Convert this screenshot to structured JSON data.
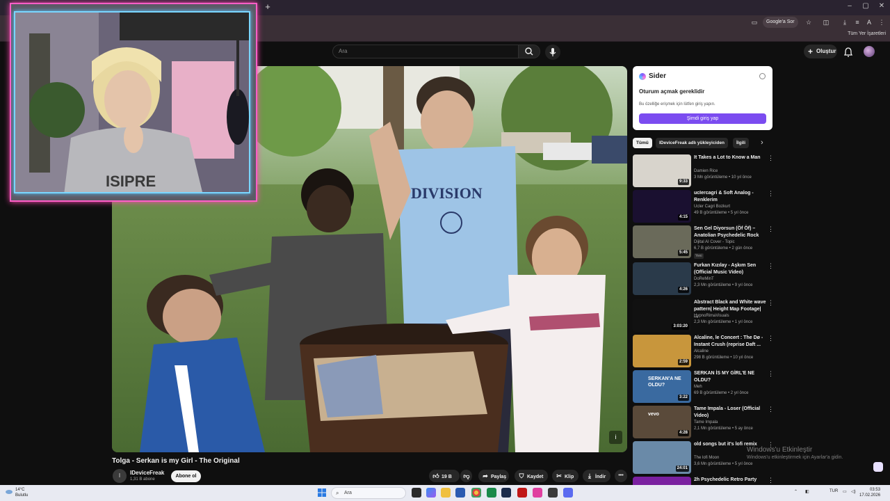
{
  "browser": {
    "new_tab": "+",
    "window_controls": [
      "–",
      "▢",
      "✕"
    ],
    "google_chip": "Google'a Sor",
    "bookmarks_all": "Tüm Yer İşaretleri",
    "profile_initial": "A"
  },
  "header": {
    "search_placeholder": "Ara",
    "create_label": "Oluştur",
    "create_icon": "plus-icon"
  },
  "video": {
    "title": "Tolga - Serkan is my Girl - The Original",
    "info_label": "i",
    "channel": {
      "avatar_initial": "I",
      "name": "IDeviceFreak",
      "subscribers": "1,31 B abone",
      "subscribe_label": "Abone ol"
    },
    "actions": {
      "likes": "19 B",
      "share": "Paylaş",
      "save": "Kaydet",
      "clip": "Klip",
      "download": "İndir",
      "more": "•••"
    }
  },
  "sider": {
    "title": "Sider",
    "heading": "Oturum açmak gereklidir",
    "description": "Bu özelliğe erişmek için lütfen giriş yapın.",
    "button": "Şimdi giriş yap"
  },
  "chips": [
    "Tümü",
    "IDeviceFreak adlı yükleyiciden",
    "İlgili"
  ],
  "recommendations": [
    {
      "title": "It Takes a Lot to Know a Man",
      "channel": "Damien Rice",
      "meta": "3 Mn görüntüleme • 10 yıl önce",
      "duration": "9:33",
      "thumb": "#d8d4cc"
    },
    {
      "title": "ucIercagri & Soft Analog - Renklerim",
      "channel": "Ucler Cagri Bozkurt",
      "meta": "49 B görüntüleme • 5 yıl önce",
      "duration": "4:15",
      "thumb": "#1a1030"
    },
    {
      "title": "Sen Gel Diyorsun (Öf Öf) – Anatolian Psychedelic Rock",
      "channel": "Dijital AI Cover - Topic",
      "meta": "6,7 B görüntüleme • 2 gün önce",
      "badge": "Yeni",
      "duration": "5:45",
      "thumb": "#6a6a5a"
    },
    {
      "title": "Furkan Kızılay - Aşkım Sen (Official Music Video)",
      "channel": "DoReMinT",
      "meta": "2,3 Mn görüntüleme • 9 yıl önce",
      "duration": "4:26",
      "thumb": "#2a3a4a"
    },
    {
      "title": "Abstract Black and White wave pattern| Height Map Footage| ...",
      "channel": "HypnoRimaVisuals",
      "meta": "2,3 Mn görüntüleme • 1 yıl önce",
      "duration": "3:03:20",
      "thumb": "#111111"
    },
    {
      "title": "Alcaline, le Concert : The Dø - Instant Crush (reprise Daft ...",
      "channel": "Alcaline",
      "meta": "298 B görüntüleme • 10 yıl önce",
      "duration": "2:59",
      "thumb": "#c8963c"
    },
    {
      "title": "SERKAN İS MY GİRL'E NE OLDU?",
      "channel": "Meh",
      "meta": "69 B görüntüleme • 2 yıl önce",
      "duration": "3:22",
      "thumb": "#3a6aa0",
      "overlay": "SERKAN'A NE OLDU?"
    },
    {
      "title": "Tame Impala - Loser (Official Video)",
      "channel": "Tame Impala",
      "meta": "2,1 Mn görüntüleme • 5 ay önce",
      "duration": "4:28",
      "thumb": "#5a4a3a",
      "overlay": "vevo"
    },
    {
      "title": "old songs but it's lofi remix",
      "channel": "The lofi Moon",
      "meta": "3,6 Mn görüntüleme • 5 yıl önce",
      "duration": "24:01",
      "thumb": "#6a8aa8"
    },
    {
      "title": "2h Psychedelic Retro Party",
      "channel": "",
      "meta": "",
      "duration": "",
      "thumb": "#7a20a0"
    }
  ],
  "watermark": {
    "line1": "Windows'u Etkinleştir",
    "line2": "Windows'u etkinleştirmek için Ayarlar'a gidin."
  },
  "taskbar": {
    "weather_temp": "14°C",
    "weather_desc": "Bulutlu",
    "search_placeholder": "Ara",
    "lang": "TUR",
    "time": "03:53",
    "date": "17.02.2026"
  },
  "colors": {
    "accent": "#ff5ec7",
    "accent2": "#7ad6ff",
    "sider_purple": "#7b4cf0",
    "bg": "#0f0f0f"
  }
}
